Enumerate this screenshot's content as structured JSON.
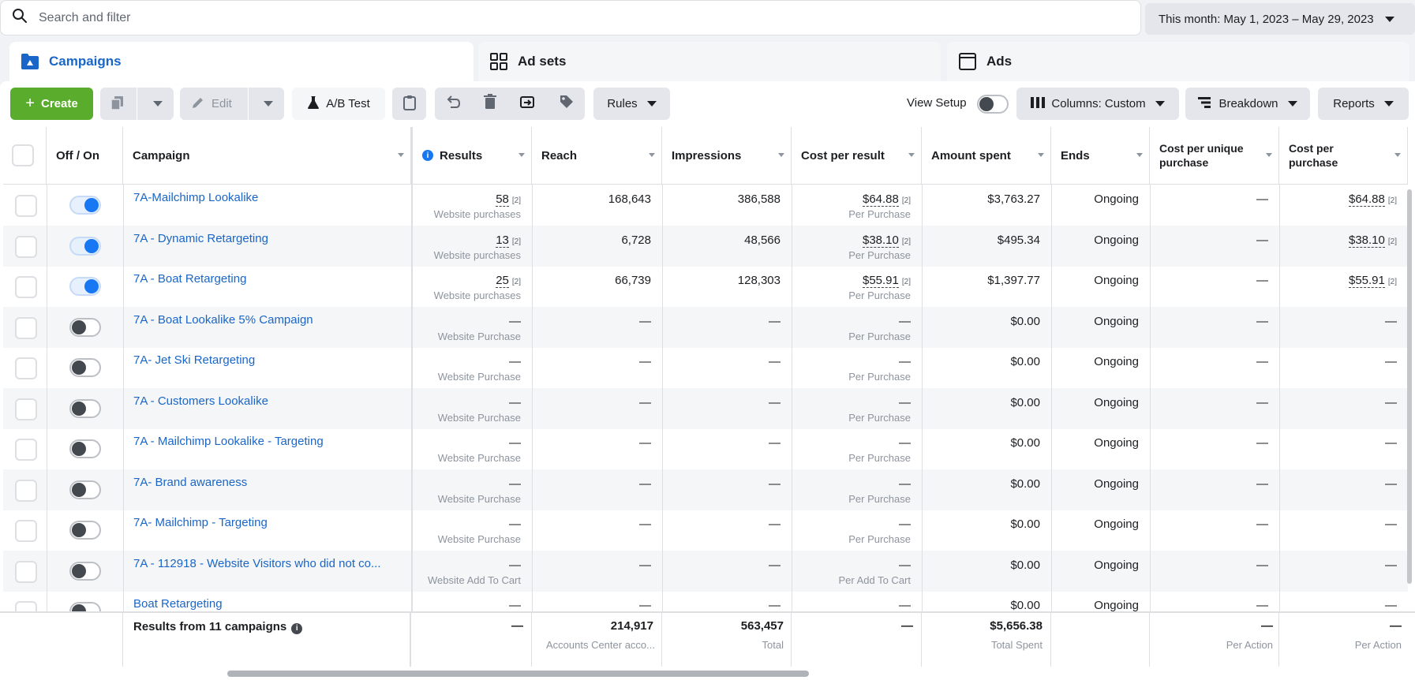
{
  "search": {
    "placeholder": "Search and filter"
  },
  "date_range": {
    "label": "This month: May 1, 2023 – May 29, 2023"
  },
  "tabs": [
    {
      "label": "Campaigns",
      "icon": "campaign-folder-icon",
      "active": true
    },
    {
      "label": "Ad sets",
      "icon": "grid-icon",
      "active": false
    },
    {
      "label": "Ads",
      "icon": "ad-window-icon",
      "active": false
    }
  ],
  "toolbar": {
    "create_label": "Create",
    "edit_label": "Edit",
    "ab_test_label": "A/B Test",
    "rules_label": "Rules",
    "view_setup_label": "View Setup",
    "columns_label": "Columns: Custom",
    "breakdown_label": "Breakdown",
    "reports_label": "Reports"
  },
  "columns": {
    "off_on": "Off / On",
    "campaign": "Campaign",
    "results": "Results",
    "reach": "Reach",
    "impressions": "Impressions",
    "cost_per_result": "Cost per result",
    "amount_spent": "Amount spent",
    "ends": "Ends",
    "cost_per_unique_purchase": "Cost per unique purchase",
    "cost_per_purchase": "Cost per purchase"
  },
  "rows": [
    {
      "name": "7A-Mailchimp Lookalike",
      "on": true,
      "results": "58",
      "results_fn": "[2]",
      "results_sub": "Website purchases",
      "reach": "168,643",
      "impressions": "386,588",
      "cpr": "$64.88",
      "cpr_fn": "[2]",
      "cpr_sub": "Per Purchase",
      "spent": "$3,763.27",
      "ends": "Ongoing",
      "cpup": "—",
      "cpp": "$64.88",
      "cpp_fn": "[2]"
    },
    {
      "name": "7A - Dynamic Retargeting",
      "on": true,
      "results": "13",
      "results_fn": "[2]",
      "results_sub": "Website purchases",
      "reach": "6,728",
      "impressions": "48,566",
      "cpr": "$38.10",
      "cpr_fn": "[2]",
      "cpr_sub": "Per Purchase",
      "spent": "$495.34",
      "ends": "Ongoing",
      "cpup": "—",
      "cpp": "$38.10",
      "cpp_fn": "[2]"
    },
    {
      "name": "7A - Boat Retargeting",
      "on": true,
      "results": "25",
      "results_fn": "[2]",
      "results_sub": "Website purchases",
      "reach": "66,739",
      "impressions": "128,303",
      "cpr": "$55.91",
      "cpr_fn": "[2]",
      "cpr_sub": "Per Purchase",
      "spent": "$1,397.77",
      "ends": "Ongoing",
      "cpup": "—",
      "cpp": "$55.91",
      "cpp_fn": "[2]"
    },
    {
      "name": "7A - Boat Lookalike 5% Campaign",
      "on": false,
      "results": "—",
      "results_fn": "",
      "results_sub": "Website Purchase",
      "reach": "—",
      "impressions": "—",
      "cpr": "—",
      "cpr_fn": "",
      "cpr_sub": "Per Purchase",
      "spent": "$0.00",
      "ends": "Ongoing",
      "cpup": "—",
      "cpp": "—",
      "cpp_fn": ""
    },
    {
      "name": "7A- Jet Ski Retargeting",
      "on": false,
      "results": "—",
      "results_fn": "",
      "results_sub": "Website Purchase",
      "reach": "—",
      "impressions": "—",
      "cpr": "—",
      "cpr_fn": "",
      "cpr_sub": "Per Purchase",
      "spent": "$0.00",
      "ends": "Ongoing",
      "cpup": "—",
      "cpp": "—",
      "cpp_fn": ""
    },
    {
      "name": "7A - Customers Lookalike",
      "on": false,
      "results": "—",
      "results_fn": "",
      "results_sub": "Website Purchase",
      "reach": "—",
      "impressions": "—",
      "cpr": "—",
      "cpr_fn": "",
      "cpr_sub": "Per Purchase",
      "spent": "$0.00",
      "ends": "Ongoing",
      "cpup": "—",
      "cpp": "—",
      "cpp_fn": ""
    },
    {
      "name": "7A - Mailchimp Lookalike - Targeting",
      "on": false,
      "results": "—",
      "results_fn": "",
      "results_sub": "Website Purchase",
      "reach": "—",
      "impressions": "—",
      "cpr": "—",
      "cpr_fn": "",
      "cpr_sub": "Per Purchase",
      "spent": "$0.00",
      "ends": "Ongoing",
      "cpup": "—",
      "cpp": "—",
      "cpp_fn": ""
    },
    {
      "name": "7A- Brand awareness",
      "on": false,
      "results": "—",
      "results_fn": "",
      "results_sub": "Website Purchase",
      "reach": "—",
      "impressions": "—",
      "cpr": "—",
      "cpr_fn": "",
      "cpr_sub": "Per Purchase",
      "spent": "$0.00",
      "ends": "Ongoing",
      "cpup": "—",
      "cpp": "—",
      "cpp_fn": ""
    },
    {
      "name": "7A- Mailchimp - Targeting",
      "on": false,
      "results": "—",
      "results_fn": "",
      "results_sub": "Website Purchase",
      "reach": "—",
      "impressions": "—",
      "cpr": "—",
      "cpr_fn": "",
      "cpr_sub": "Per Purchase",
      "spent": "$0.00",
      "ends": "Ongoing",
      "cpup": "—",
      "cpp": "—",
      "cpp_fn": ""
    },
    {
      "name": "7A - 112918 - Website Visitors who did not co...",
      "on": false,
      "results": "—",
      "results_fn": "",
      "results_sub": "Website Add To Cart",
      "reach": "—",
      "impressions": "—",
      "cpr": "—",
      "cpr_fn": "",
      "cpr_sub": "Per Add To Cart",
      "spent": "$0.00",
      "ends": "Ongoing",
      "cpup": "—",
      "cpp": "—",
      "cpp_fn": ""
    },
    {
      "name": "Boat Retargeting",
      "on": false,
      "results": "—",
      "results_fn": "",
      "results_sub": "",
      "reach": "—",
      "impressions": "—",
      "cpr": "—",
      "cpr_fn": "",
      "cpr_sub": "",
      "spent": "$0.00",
      "ends": "Ongoing",
      "cpup": "—",
      "cpp": "—",
      "cpp_fn": ""
    }
  ],
  "footer": {
    "label": "Results from 11 campaigns",
    "results": "—",
    "reach": "214,917",
    "reach_sub": "Accounts Center acco...",
    "impressions": "563,457",
    "impressions_sub": "Total",
    "cpr": "—",
    "spent": "$5,656.38",
    "spent_sub": "Total Spent",
    "cpup": "—",
    "cpup_sub": "Per Action",
    "cpp": "—",
    "cpp_sub": "Per Action"
  },
  "colors": {
    "accent": "#1a66c8",
    "create_green": "#5aac2c",
    "toggle_on": "#1877f2"
  }
}
